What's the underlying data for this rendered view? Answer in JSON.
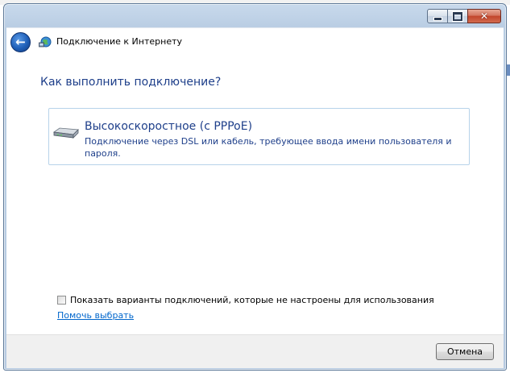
{
  "window": {
    "title": "Подключение к Интернету",
    "caption_buttons": {
      "minimize_icon": "minimize-icon",
      "maximize_icon": "maximize-icon",
      "close_icon": "close-icon",
      "close_glyph": "✕"
    }
  },
  "nav": {
    "back_icon": "back-arrow-icon",
    "back_glyph": "←",
    "app_icon": "network-globe-icon"
  },
  "main": {
    "heading": "Как выполнить подключение?",
    "options": [
      {
        "icon": "modem-icon",
        "title": "Высокоскоростное (с PPPoE)",
        "description": "Подключение через DSL или кабель, требующее ввода имени пользователя и пароля."
      }
    ],
    "show_all_checkbox": {
      "label": "Показать варианты подключений, которые не настроены для использования",
      "checked": false
    },
    "help_link": "Помочь выбрать"
  },
  "footer": {
    "cancel_label": "Отмена"
  },
  "colors": {
    "heading": "#1e3f8a",
    "link": "#0066cc",
    "card_border": "#b7d3ea",
    "footer_bg": "#f0f0f0"
  }
}
